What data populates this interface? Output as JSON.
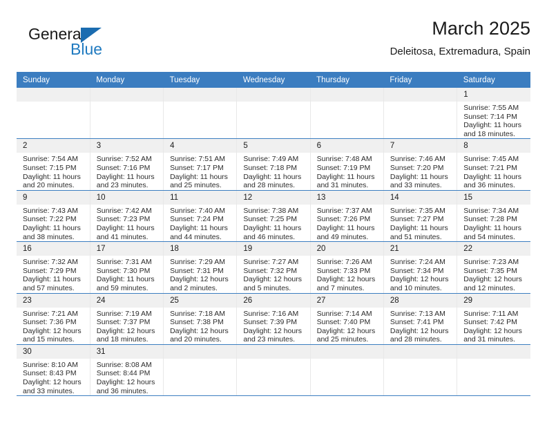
{
  "brand": {
    "name_top": "General",
    "name_bottom": "Blue",
    "triangle_color": "#1b6cb0",
    "blue_color": "#1f7ac0"
  },
  "header": {
    "title": "March 2025",
    "subtitle": "Deleitosa, Extremadura, Spain"
  },
  "theme": {
    "header_bg": "#3b7dc0",
    "daynum_bg": "#f0f0f0",
    "row_divider": "#3b7dc0"
  },
  "weekdays": [
    "Sunday",
    "Monday",
    "Tuesday",
    "Wednesday",
    "Thursday",
    "Friday",
    "Saturday"
  ],
  "labels": {
    "sunrise": "Sunrise:",
    "sunset": "Sunset:",
    "daylight": "Daylight:"
  },
  "weeks": [
    [
      {
        "day": "",
        "empty": true
      },
      {
        "day": "",
        "empty": true
      },
      {
        "day": "",
        "empty": true
      },
      {
        "day": "",
        "empty": true
      },
      {
        "day": "",
        "empty": true
      },
      {
        "day": "",
        "empty": true
      },
      {
        "day": "1",
        "sunrise": "Sunrise: 7:55 AM",
        "sunset": "Sunset: 7:14 PM",
        "daylight_l1": "Daylight: 11 hours",
        "daylight_l2": "and 18 minutes."
      }
    ],
    [
      {
        "day": "2",
        "sunrise": "Sunrise: 7:54 AM",
        "sunset": "Sunset: 7:15 PM",
        "daylight_l1": "Daylight: 11 hours",
        "daylight_l2": "and 20 minutes."
      },
      {
        "day": "3",
        "sunrise": "Sunrise: 7:52 AM",
        "sunset": "Sunset: 7:16 PM",
        "daylight_l1": "Daylight: 11 hours",
        "daylight_l2": "and 23 minutes."
      },
      {
        "day": "4",
        "sunrise": "Sunrise: 7:51 AM",
        "sunset": "Sunset: 7:17 PM",
        "daylight_l1": "Daylight: 11 hours",
        "daylight_l2": "and 25 minutes."
      },
      {
        "day": "5",
        "sunrise": "Sunrise: 7:49 AM",
        "sunset": "Sunset: 7:18 PM",
        "daylight_l1": "Daylight: 11 hours",
        "daylight_l2": "and 28 minutes."
      },
      {
        "day": "6",
        "sunrise": "Sunrise: 7:48 AM",
        "sunset": "Sunset: 7:19 PM",
        "daylight_l1": "Daylight: 11 hours",
        "daylight_l2": "and 31 minutes."
      },
      {
        "day": "7",
        "sunrise": "Sunrise: 7:46 AM",
        "sunset": "Sunset: 7:20 PM",
        "daylight_l1": "Daylight: 11 hours",
        "daylight_l2": "and 33 minutes."
      },
      {
        "day": "8",
        "sunrise": "Sunrise: 7:45 AM",
        "sunset": "Sunset: 7:21 PM",
        "daylight_l1": "Daylight: 11 hours",
        "daylight_l2": "and 36 minutes."
      }
    ],
    [
      {
        "day": "9",
        "sunrise": "Sunrise: 7:43 AM",
        "sunset": "Sunset: 7:22 PM",
        "daylight_l1": "Daylight: 11 hours",
        "daylight_l2": "and 38 minutes."
      },
      {
        "day": "10",
        "sunrise": "Sunrise: 7:42 AM",
        "sunset": "Sunset: 7:23 PM",
        "daylight_l1": "Daylight: 11 hours",
        "daylight_l2": "and 41 minutes."
      },
      {
        "day": "11",
        "sunrise": "Sunrise: 7:40 AM",
        "sunset": "Sunset: 7:24 PM",
        "daylight_l1": "Daylight: 11 hours",
        "daylight_l2": "and 44 minutes."
      },
      {
        "day": "12",
        "sunrise": "Sunrise: 7:38 AM",
        "sunset": "Sunset: 7:25 PM",
        "daylight_l1": "Daylight: 11 hours",
        "daylight_l2": "and 46 minutes."
      },
      {
        "day": "13",
        "sunrise": "Sunrise: 7:37 AM",
        "sunset": "Sunset: 7:26 PM",
        "daylight_l1": "Daylight: 11 hours",
        "daylight_l2": "and 49 minutes."
      },
      {
        "day": "14",
        "sunrise": "Sunrise: 7:35 AM",
        "sunset": "Sunset: 7:27 PM",
        "daylight_l1": "Daylight: 11 hours",
        "daylight_l2": "and 51 minutes."
      },
      {
        "day": "15",
        "sunrise": "Sunrise: 7:34 AM",
        "sunset": "Sunset: 7:28 PM",
        "daylight_l1": "Daylight: 11 hours",
        "daylight_l2": "and 54 minutes."
      }
    ],
    [
      {
        "day": "16",
        "sunrise": "Sunrise: 7:32 AM",
        "sunset": "Sunset: 7:29 PM",
        "daylight_l1": "Daylight: 11 hours",
        "daylight_l2": "and 57 minutes."
      },
      {
        "day": "17",
        "sunrise": "Sunrise: 7:31 AM",
        "sunset": "Sunset: 7:30 PM",
        "daylight_l1": "Daylight: 11 hours",
        "daylight_l2": "and 59 minutes."
      },
      {
        "day": "18",
        "sunrise": "Sunrise: 7:29 AM",
        "sunset": "Sunset: 7:31 PM",
        "daylight_l1": "Daylight: 12 hours",
        "daylight_l2": "and 2 minutes."
      },
      {
        "day": "19",
        "sunrise": "Sunrise: 7:27 AM",
        "sunset": "Sunset: 7:32 PM",
        "daylight_l1": "Daylight: 12 hours",
        "daylight_l2": "and 5 minutes."
      },
      {
        "day": "20",
        "sunrise": "Sunrise: 7:26 AM",
        "sunset": "Sunset: 7:33 PM",
        "daylight_l1": "Daylight: 12 hours",
        "daylight_l2": "and 7 minutes."
      },
      {
        "day": "21",
        "sunrise": "Sunrise: 7:24 AM",
        "sunset": "Sunset: 7:34 PM",
        "daylight_l1": "Daylight: 12 hours",
        "daylight_l2": "and 10 minutes."
      },
      {
        "day": "22",
        "sunrise": "Sunrise: 7:23 AM",
        "sunset": "Sunset: 7:35 PM",
        "daylight_l1": "Daylight: 12 hours",
        "daylight_l2": "and 12 minutes."
      }
    ],
    [
      {
        "day": "23",
        "sunrise": "Sunrise: 7:21 AM",
        "sunset": "Sunset: 7:36 PM",
        "daylight_l1": "Daylight: 12 hours",
        "daylight_l2": "and 15 minutes."
      },
      {
        "day": "24",
        "sunrise": "Sunrise: 7:19 AM",
        "sunset": "Sunset: 7:37 PM",
        "daylight_l1": "Daylight: 12 hours",
        "daylight_l2": "and 18 minutes."
      },
      {
        "day": "25",
        "sunrise": "Sunrise: 7:18 AM",
        "sunset": "Sunset: 7:38 PM",
        "daylight_l1": "Daylight: 12 hours",
        "daylight_l2": "and 20 minutes."
      },
      {
        "day": "26",
        "sunrise": "Sunrise: 7:16 AM",
        "sunset": "Sunset: 7:39 PM",
        "daylight_l1": "Daylight: 12 hours",
        "daylight_l2": "and 23 minutes."
      },
      {
        "day": "27",
        "sunrise": "Sunrise: 7:14 AM",
        "sunset": "Sunset: 7:40 PM",
        "daylight_l1": "Daylight: 12 hours",
        "daylight_l2": "and 25 minutes."
      },
      {
        "day": "28",
        "sunrise": "Sunrise: 7:13 AM",
        "sunset": "Sunset: 7:41 PM",
        "daylight_l1": "Daylight: 12 hours",
        "daylight_l2": "and 28 minutes."
      },
      {
        "day": "29",
        "sunrise": "Sunrise: 7:11 AM",
        "sunset": "Sunset: 7:42 PM",
        "daylight_l1": "Daylight: 12 hours",
        "daylight_l2": "and 31 minutes."
      }
    ],
    [
      {
        "day": "30",
        "sunrise": "Sunrise: 8:10 AM",
        "sunset": "Sunset: 8:43 PM",
        "daylight_l1": "Daylight: 12 hours",
        "daylight_l2": "and 33 minutes."
      },
      {
        "day": "31",
        "sunrise": "Sunrise: 8:08 AM",
        "sunset": "Sunset: 8:44 PM",
        "daylight_l1": "Daylight: 12 hours",
        "daylight_l2": "and 36 minutes."
      },
      {
        "day": "",
        "empty": true
      },
      {
        "day": "",
        "empty": true
      },
      {
        "day": "",
        "empty": true
      },
      {
        "day": "",
        "empty": true
      },
      {
        "day": "",
        "empty": true
      }
    ]
  ]
}
